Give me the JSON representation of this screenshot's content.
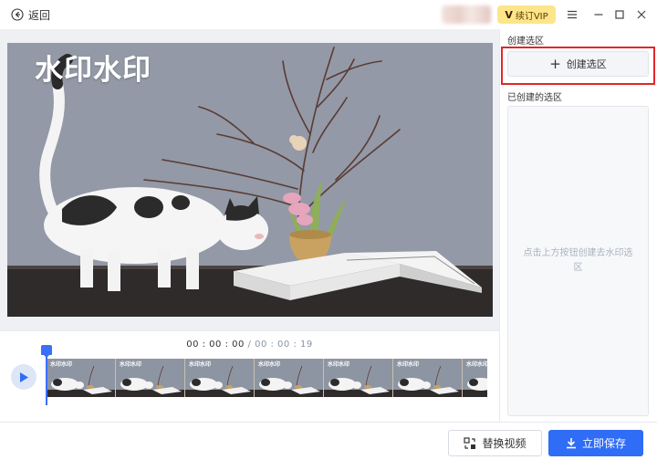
{
  "header": {
    "back_label": "返回",
    "vip_label": "续订VIP"
  },
  "preview": {
    "watermark_text": "水印水印"
  },
  "timeline": {
    "current_time": "00 : 00 : 00",
    "separator": " / ",
    "total_time": "00 : 00 : 19",
    "playhead_progress": 0,
    "frame_count": 7,
    "frame_watermark": "水印水印"
  },
  "right_panel": {
    "create_section_label": "创建选区",
    "create_button_label": "创建选区",
    "created_section_label": "已创建的选区",
    "empty_hint": "点击上方按钮创建去水印选区"
  },
  "footer": {
    "replace_label": "替换视频",
    "save_label": "立即保存"
  },
  "colors": {
    "accent": "#2f6df6",
    "highlight_border": "#e2262c",
    "vip_bg": "#fde58a"
  }
}
